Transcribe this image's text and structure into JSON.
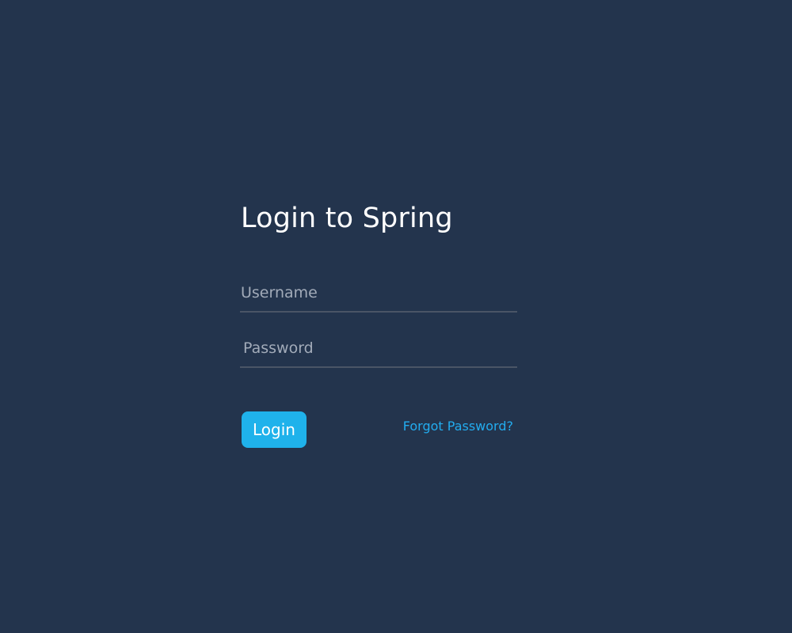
{
  "login": {
    "title": "Login to Spring",
    "username_placeholder": "Username",
    "password_placeholder": "Password",
    "login_button": "Login",
    "forgot_password": "Forgot Password?"
  },
  "colors": {
    "background": "#23344d",
    "accent": "#1fb2eb",
    "link": "#23acef",
    "title_text": "#ffffff",
    "placeholder_text": "#a2abb9",
    "field_underline": "#4a5566"
  }
}
